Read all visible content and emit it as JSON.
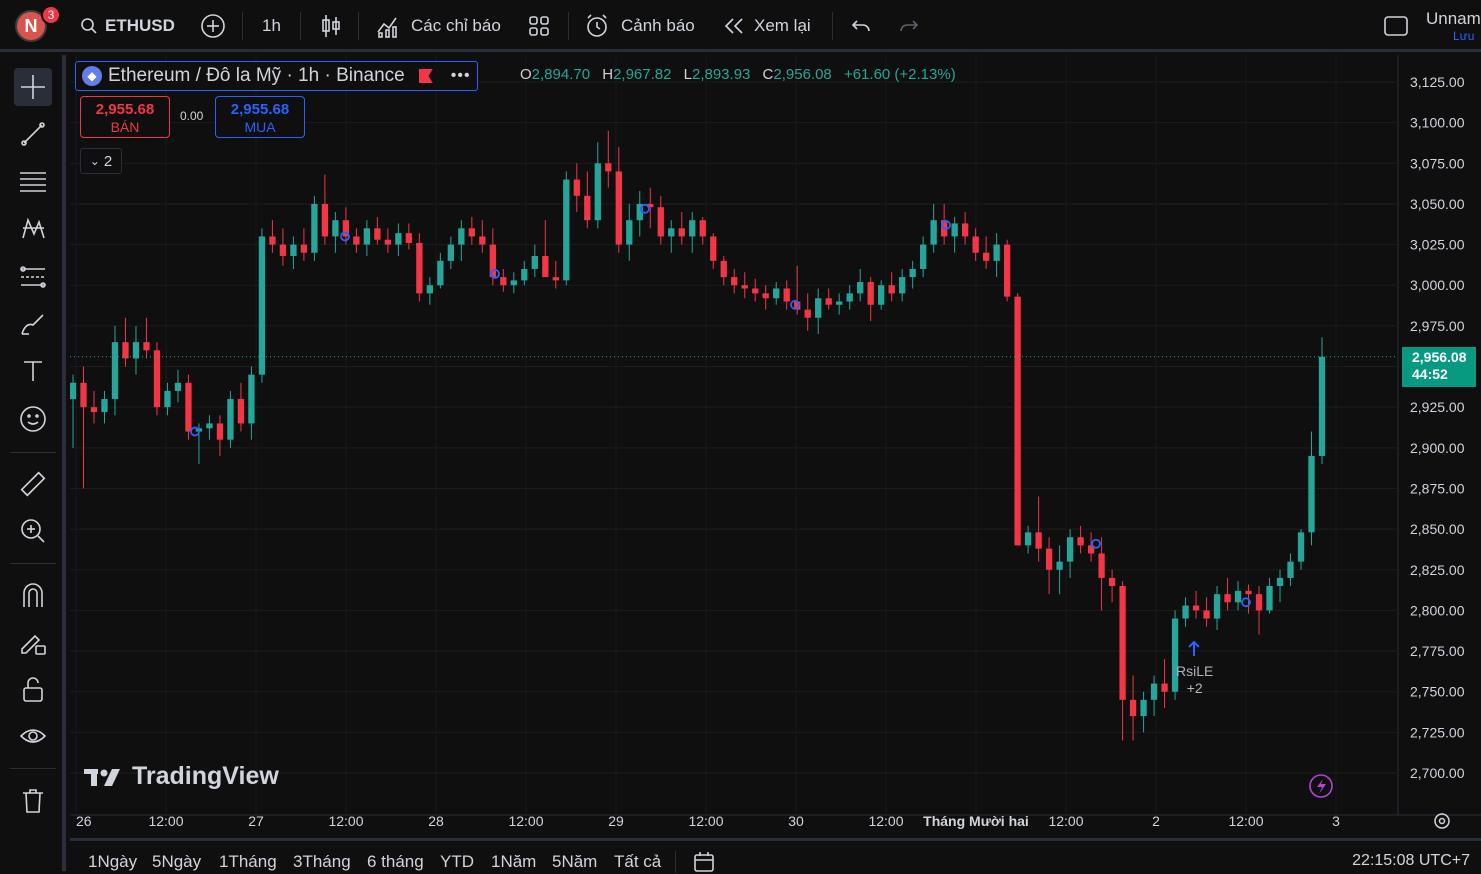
{
  "topbar": {
    "avatar_letter": "N",
    "notification_count": "3",
    "symbol": "ETHUSD",
    "interval": "1h",
    "indicators_label": "Các chỉ báo",
    "alerts_label": "Cảnh báo",
    "replay_label": "Xem lại",
    "layout_name": "Unnam",
    "save_label": "Lưu"
  },
  "legend": {
    "title": "Ethereum / Đô la Mỹ · 1h · Binance",
    "eth_glyph": "◆",
    "more": "•••",
    "o_key": "O",
    "o": "2,894.70",
    "h_key": "H",
    "h": "2,967.82",
    "l_key": "L",
    "l": "2,893.93",
    "c_key": "C",
    "c": "2,956.08",
    "change": "+61.60 (+2.13%)"
  },
  "trade": {
    "sell_price": "2,955.68",
    "sell_label": "BÁN",
    "spread": "0.00",
    "buy_price": "2,955.68",
    "buy_label": "MUA",
    "collapse_count": "2"
  },
  "price_axis": {
    "ticks": [
      "3,125.00",
      "3,100.00",
      "3,075.00",
      "3,050.00",
      "3,025.00",
      "3,000.00",
      "2,975.00",
      "2,950.00",
      "2,925.00",
      "2,900.00",
      "2,875.00",
      "2,850.00",
      "2,825.00",
      "2,800.00",
      "2,775.00",
      "2,750.00",
      "2,725.00",
      "2,700.00"
    ],
    "current_price": "2,956.08",
    "countdown": "44:52"
  },
  "time_axis": {
    "labels": [
      "26",
      "12:00",
      "27",
      "12:00",
      "28",
      "12:00",
      "29",
      "12:00",
      "30",
      "12:00",
      "Tháng Mười hai",
      "12:00",
      "2",
      "12:00",
      "3"
    ]
  },
  "annotation": {
    "line1": "RsiLE",
    "line2": "+2"
  },
  "watermark": "TradingView",
  "bottom": {
    "ranges": [
      "1Ngày",
      "5Ngày",
      "1Tháng",
      "3Tháng",
      "6 tháng",
      "YTD",
      "1Năm",
      "5Năm",
      "Tất cả"
    ],
    "clock": "22:15:08 UTC+7"
  },
  "colors": {
    "up": "#26a69a",
    "down": "#f23645",
    "accent": "#2962ff",
    "background": "#0f0f0f"
  },
  "chart_data": {
    "type": "candlestick",
    "title": "Ethereum / Đô la Mỹ · 1h · Binance",
    "ylim": [
      2690,
      3135
    ],
    "candles": [
      [
        2930,
        2945,
        2900,
        2940
      ],
      [
        2940,
        2950,
        2875,
        2925
      ],
      [
        2925,
        2935,
        2915,
        2922
      ],
      [
        2922,
        2935,
        2915,
        2930
      ],
      [
        2930,
        2975,
        2920,
        2965
      ],
      [
        2965,
        2980,
        2950,
        2955
      ],
      [
        2955,
        2975,
        2945,
        2965
      ],
      [
        2965,
        2980,
        2955,
        2960
      ],
      [
        2960,
        2965,
        2920,
        2925
      ],
      [
        2925,
        2940,
        2920,
        2935
      ],
      [
        2935,
        2948,
        2928,
        2940
      ],
      [
        2940,
        2945,
        2905,
        2910
      ],
      [
        2910,
        2915,
        2890,
        2912
      ],
      [
        2912,
        2920,
        2905,
        2915
      ],
      [
        2915,
        2920,
        2895,
        2905
      ],
      [
        2905,
        2935,
        2900,
        2930
      ],
      [
        2930,
        2940,
        2910,
        2915
      ],
      [
        2915,
        2950,
        2905,
        2945
      ],
      [
        2945,
        3035,
        2940,
        3030
      ],
      [
        3030,
        3040,
        3020,
        3025
      ],
      [
        3025,
        3035,
        3012,
        3018
      ],
      [
        3018,
        3030,
        3010,
        3025
      ],
      [
        3025,
        3035,
        3015,
        3020
      ],
      [
        3020,
        3055,
        3015,
        3050
      ],
      [
        3050,
        3068,
        3025,
        3030
      ],
      [
        3030,
        3045,
        3020,
        3040
      ],
      [
        3040,
        3048,
        3025,
        3030
      ],
      [
        3030,
        3035,
        3020,
        3025
      ],
      [
        3025,
        3040,
        3018,
        3035
      ],
      [
        3035,
        3042,
        3025,
        3028
      ],
      [
        3028,
        3035,
        3020,
        3025
      ],
      [
        3025,
        3038,
        3018,
        3032
      ],
      [
        3032,
        3038,
        3022,
        3026
      ],
      [
        3026,
        3032,
        2990,
        2995
      ],
      [
        2995,
        3005,
        2988,
        3000
      ],
      [
        3000,
        3020,
        2998,
        3015
      ],
      [
        3015,
        3030,
        3010,
        3025
      ],
      [
        3025,
        3040,
        3015,
        3035
      ],
      [
        3035,
        3042,
        3025,
        3030
      ],
      [
        3030,
        3040,
        3020,
        3025
      ],
      [
        3025,
        3035,
        3000,
        3005
      ],
      [
        3005,
        3010,
        2996,
        3000
      ],
      [
        3000,
        3008,
        2995,
        3003
      ],
      [
        3003,
        3015,
        3000,
        3010
      ],
      [
        3010,
        3025,
        3005,
        3018
      ],
      [
        3018,
        3040,
        3010,
        3005
      ],
      [
        3005,
        3015,
        2998,
        3003
      ],
      [
        3003,
        3070,
        3000,
        3065
      ],
      [
        3065,
        3075,
        3045,
        3055
      ],
      [
        3055,
        3070,
        3035,
        3040
      ],
      [
        3040,
        3088,
        3035,
        3075
      ],
      [
        3075,
        3095,
        3060,
        3070
      ],
      [
        3070,
        3085,
        3020,
        3025
      ],
      [
        3025,
        3050,
        3015,
        3040
      ],
      [
        3040,
        3058,
        3030,
        3050
      ],
      [
        3050,
        3060,
        3035,
        3048
      ],
      [
        3048,
        3055,
        3025,
        3030
      ],
      [
        3030,
        3040,
        3020,
        3035
      ],
      [
        3035,
        3045,
        3025,
        3030
      ],
      [
        3030,
        3045,
        3020,
        3040
      ],
      [
        3040,
        3042,
        3025,
        3030
      ],
      [
        3030,
        3032,
        3010,
        3015
      ],
      [
        3015,
        3018,
        3000,
        3005
      ],
      [
        3005,
        3010,
        2995,
        3000
      ],
      [
        3000,
        3008,
        2992,
        2998
      ],
      [
        2998,
        3004,
        2990,
        2995
      ],
      [
        2995,
        3000,
        2985,
        2992
      ],
      [
        2992,
        3002,
        2988,
        2998
      ],
      [
        2998,
        3003,
        2985,
        2990
      ],
      [
        2990,
        3012,
        2982,
        2985
      ],
      [
        2985,
        2995,
        2972,
        2980
      ],
      [
        2980,
        2998,
        2970,
        2992
      ],
      [
        2992,
        2998,
        2985,
        2988
      ],
      [
        2988,
        2995,
        2982,
        2990
      ],
      [
        2990,
        3000,
        2985,
        2995
      ],
      [
        2995,
        3010,
        2990,
        3002
      ],
      [
        3002,
        3005,
        2978,
        2988
      ],
      [
        2988,
        3003,
        2985,
        3000
      ],
      [
        3000,
        3008,
        2990,
        2995
      ],
      [
        2995,
        3010,
        2990,
        3005
      ],
      [
        3005,
        3015,
        2998,
        3010
      ],
      [
        3010,
        3030,
        3005,
        3025
      ],
      [
        3025,
        3050,
        3020,
        3040
      ],
      [
        3040,
        3050,
        3025,
        3030
      ],
      [
        3030,
        3042,
        3020,
        3038
      ],
      [
        3038,
        3045,
        3025,
        3030
      ],
      [
        3030,
        3035,
        3015,
        3020
      ],
      [
        3020,
        3030,
        3010,
        3015
      ],
      [
        3015,
        3032,
        3005,
        3025
      ],
      [
        3025,
        3028,
        2990,
        2993
      ],
      [
        2993,
        2995,
        2840,
        2840
      ],
      [
        2840,
        2852,
        2835,
        2848
      ],
      [
        2848,
        2870,
        2830,
        2838
      ],
      [
        2838,
        2845,
        2810,
        2825
      ],
      [
        2825,
        2840,
        2810,
        2830
      ],
      [
        2830,
        2850,
        2820,
        2845
      ],
      [
        2845,
        2852,
        2835,
        2840
      ],
      [
        2840,
        2848,
        2830,
        2835
      ],
      [
        2835,
        2845,
        2800,
        2820
      ],
      [
        2820,
        2825,
        2805,
        2815
      ],
      [
        2815,
        2818,
        2720,
        2745
      ],
      [
        2745,
        2760,
        2720,
        2735
      ],
      [
        2735,
        2750,
        2725,
        2745
      ],
      [
        2745,
        2760,
        2735,
        2755
      ],
      [
        2755,
        2770,
        2740,
        2750
      ],
      [
        2750,
        2800,
        2745,
        2795
      ],
      [
        2795,
        2808,
        2790,
        2803
      ],
      [
        2803,
        2812,
        2795,
        2800
      ],
      [
        2800,
        2808,
        2790,
        2795
      ],
      [
        2795,
        2815,
        2788,
        2810
      ],
      [
        2810,
        2820,
        2800,
        2805
      ],
      [
        2805,
        2818,
        2800,
        2812
      ],
      [
        2812,
        2816,
        2798,
        2810
      ],
      [
        2810,
        2815,
        2785,
        2800
      ],
      [
        2800,
        2820,
        2798,
        2815
      ],
      [
        2815,
        2825,
        2805,
        2820
      ],
      [
        2820,
        2835,
        2815,
        2830
      ],
      [
        2830,
        2850,
        2825,
        2848
      ],
      [
        2848,
        2910,
        2840,
        2895
      ],
      [
        2895,
        2968,
        2890,
        2956
      ]
    ]
  }
}
